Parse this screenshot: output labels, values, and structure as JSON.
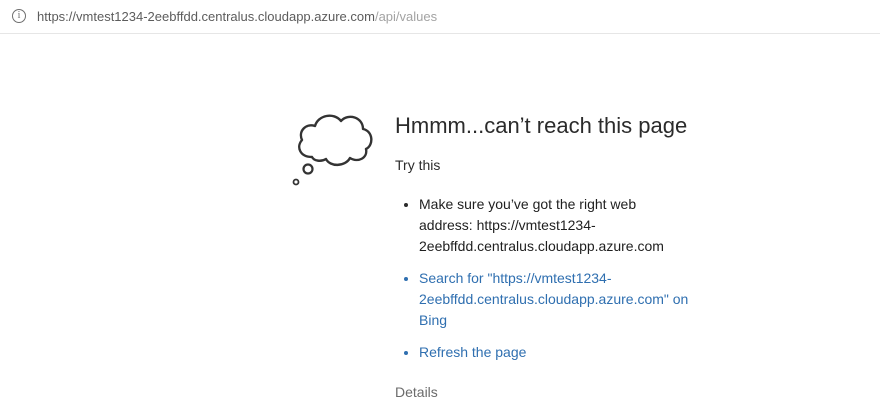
{
  "address_bar": {
    "icon": "info-icon",
    "icon_glyph": "i",
    "url_host": "https://vmtest1234-2eebffdd.centralus.cloudapp.azure.com",
    "url_path": "/api/values"
  },
  "error_page": {
    "illustration": "thought-cloud-icon",
    "title": "Hmmm...can’t reach this page",
    "try_this": "Try this",
    "suggestions": [
      {
        "lines": [
          "Make sure you’ve got the right web",
          "address: https://vmtest1234-",
          "2eebffdd.centralus.cloudapp.azure.com"
        ]
      },
      {
        "lines": [
          "Search for \"https://vmtest1234-",
          "2eebffdd.centralus.cloudapp.azure.com\" on",
          "Bing"
        ]
      },
      {
        "lines": [
          "Refresh the page"
        ]
      }
    ],
    "details": "Details"
  },
  "colors": {
    "link": "#2f6fb0",
    "text": "#1f1f1f",
    "muted": "#6b6b6b"
  }
}
